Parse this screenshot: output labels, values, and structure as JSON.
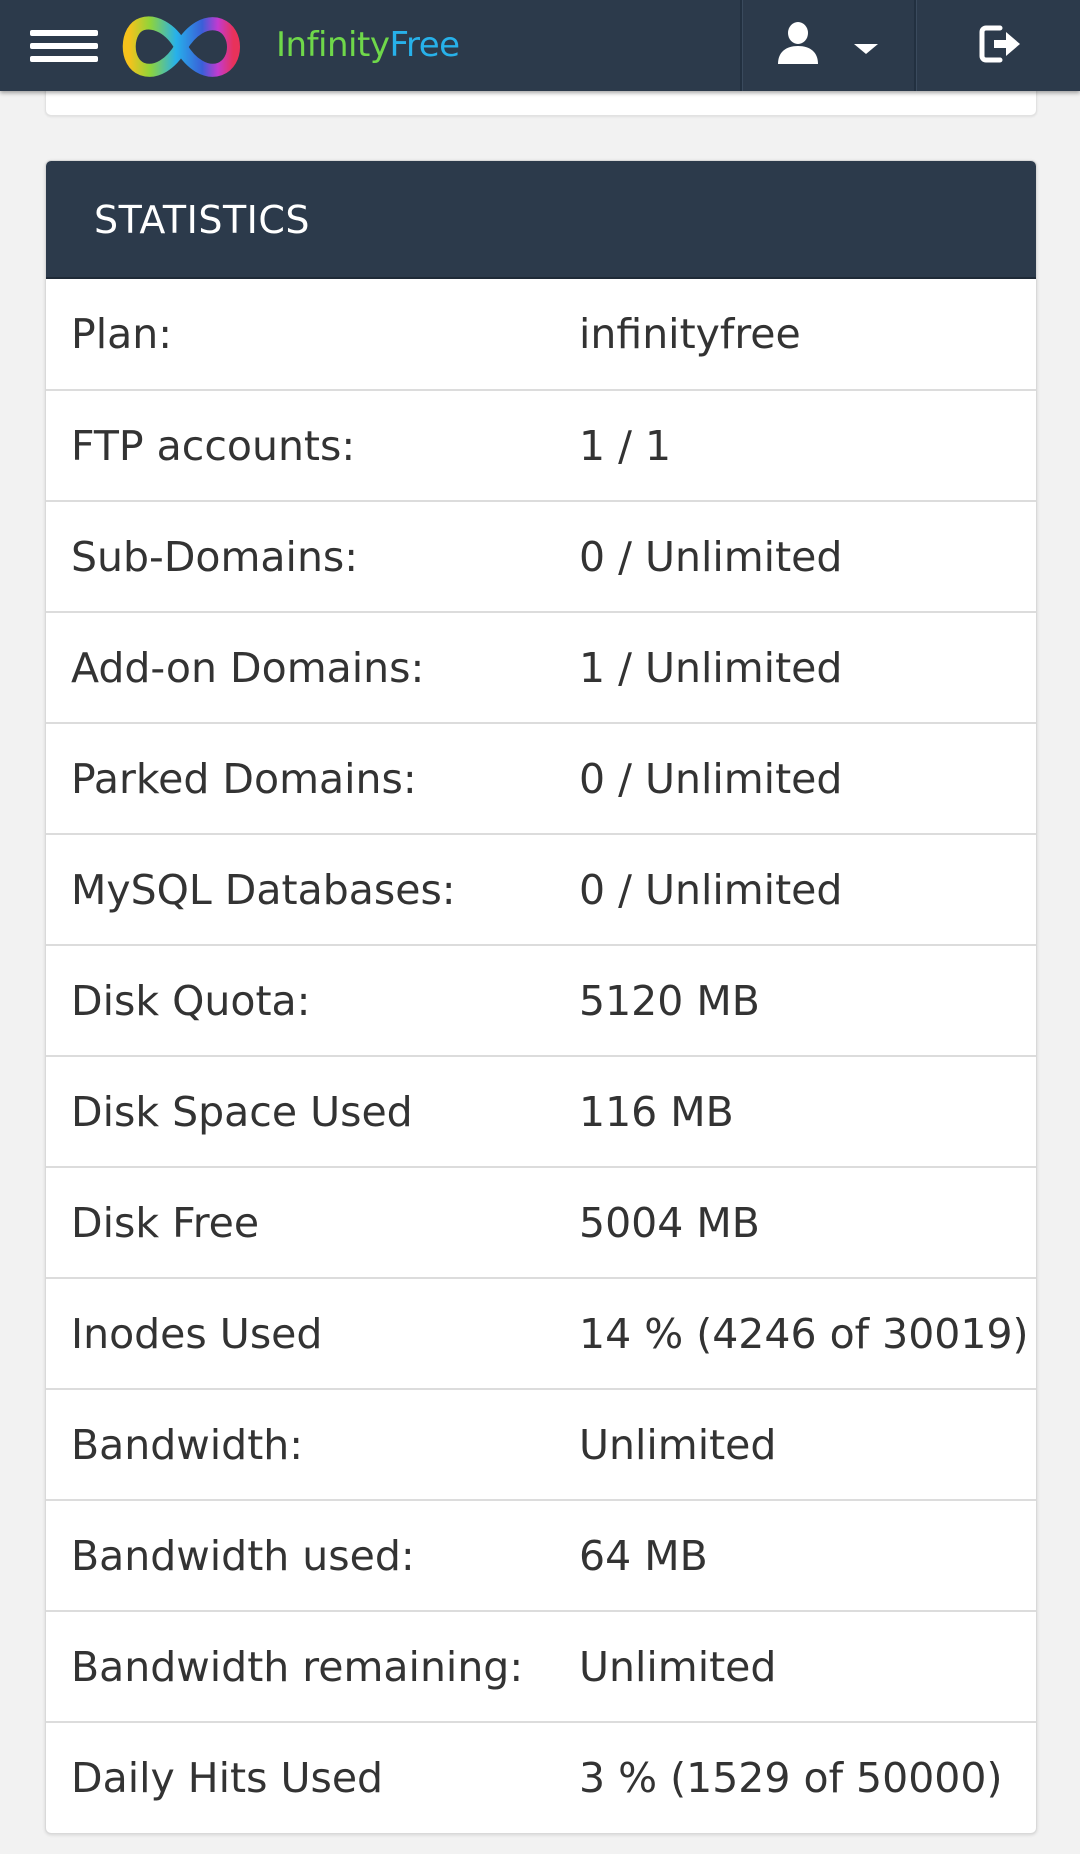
{
  "navbar": {
    "brand_part1": "Infinity",
    "brand_part2": "Free",
    "menu_icon": "hamburger-menu-icon",
    "logo_icon": "infinity-logo-icon",
    "user_icon": "user-icon",
    "caret_icon": "caret-down-icon",
    "logout_icon": "logout-icon",
    "colors": {
      "navbar_bg": "#2c3a4b",
      "brand_green": "#6fd84a",
      "brand_blue": "#27b1ea"
    }
  },
  "statistics": {
    "title": "STATISTICS",
    "rows": [
      {
        "label": "Plan:",
        "value": "infinityfree"
      },
      {
        "label": "FTP accounts:",
        "value": "1 / 1"
      },
      {
        "label": "Sub-Domains:",
        "value": "0 / Unlimited"
      },
      {
        "label": "Add-on Domains:",
        "value": "1 / Unlimited"
      },
      {
        "label": "Parked Domains:",
        "value": "0 / Unlimited"
      },
      {
        "label": "MySQL Databases:",
        "value": "0 / Unlimited"
      },
      {
        "label": "Disk Quota:",
        "value": "5120 MB"
      },
      {
        "label": "Disk Space Used",
        "value": "116 MB"
      },
      {
        "label": "Disk Free",
        "value": "5004 MB"
      },
      {
        "label": "Inodes Used",
        "value": "14 % (4246 of 30019)"
      },
      {
        "label": "Bandwidth:",
        "value": "Unlimited"
      },
      {
        "label": "Bandwidth used:",
        "value": "64 MB"
      },
      {
        "label": "Bandwidth remaining:",
        "value": "Unlimited"
      },
      {
        "label": "Daily Hits Used",
        "value": "3 % (1529 of 50000)"
      }
    ]
  }
}
